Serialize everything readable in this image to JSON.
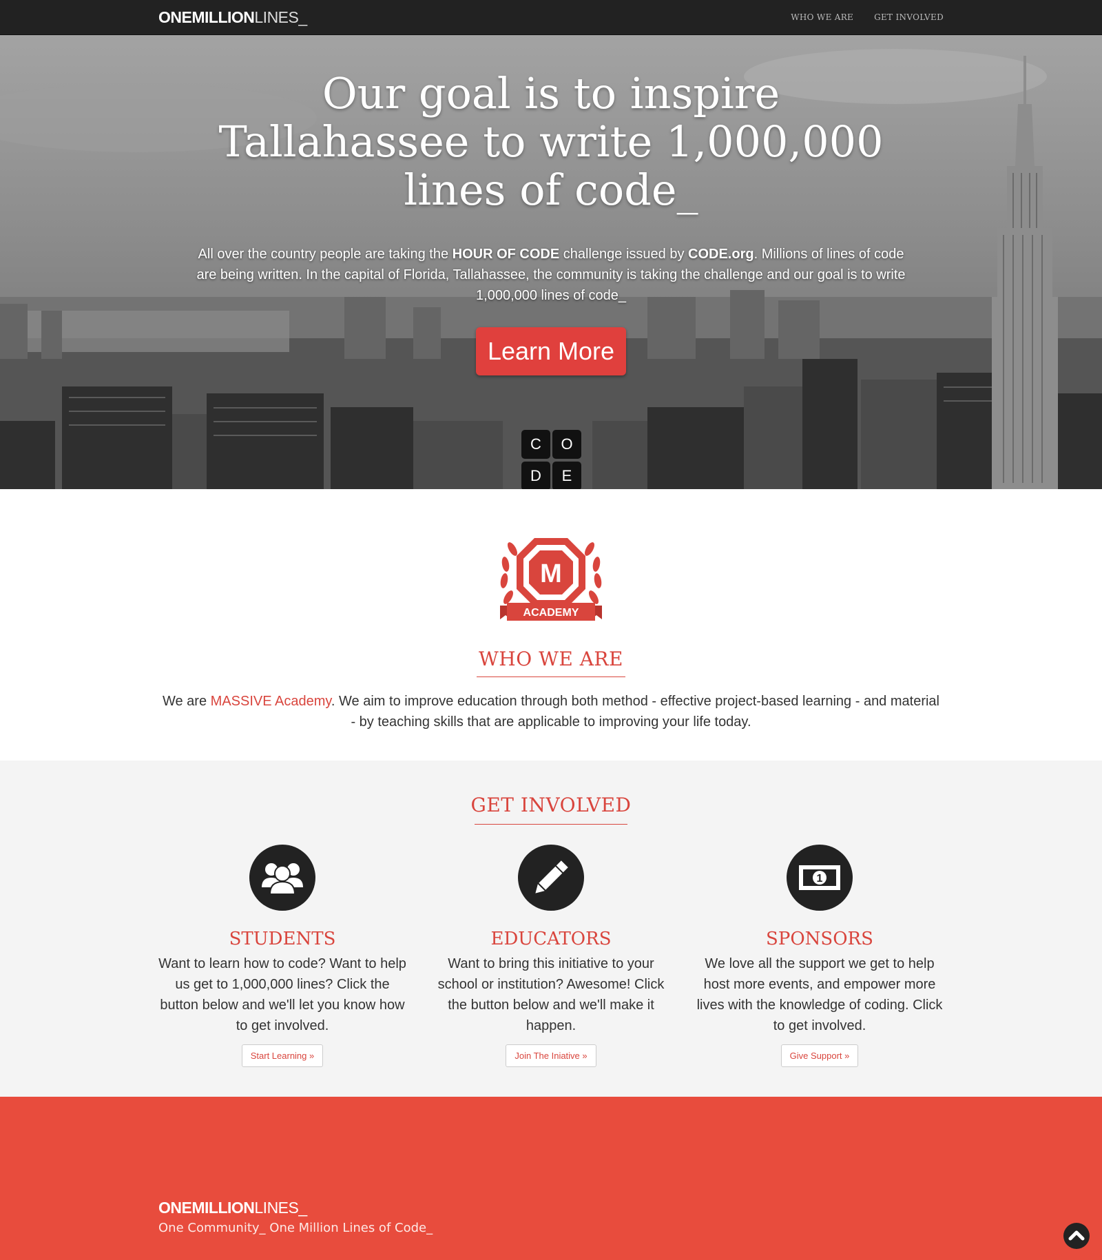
{
  "navbar": {
    "brand_bold": "ONEMILLION",
    "brand_thin": "LINES_",
    "links": [
      "WHO WE ARE",
      "GET INVOLVED"
    ]
  },
  "hero": {
    "title": "Our goal is to inspire Tallahassee to write 1,000,000 lines of code_",
    "text_1": "All over the country people are taking the ",
    "text_hour": "HOUR OF CODE",
    "text_2": " challenge issued by ",
    "text_codeorg": "CODE.org",
    "text_3": ". Millions of lines of code are being written. In the capital of Florida, Tallahassee, the community is taking the challenge and our goal is to write 1,000,000 lines of code_",
    "button": "Learn More",
    "code_letters": [
      "C",
      "O",
      "D",
      "E"
    ]
  },
  "who": {
    "badge_letter": "M",
    "badge_ribbon": "ACADEMY",
    "title": "WHO WE ARE",
    "text_1": "We are ",
    "text_accent": "MASSIVE Academy",
    "text_2": ". We aim to improve education through both method - effective project-based learning - and material - by teaching skills that are applicable to improving your life today."
  },
  "involved": {
    "title": "GET INVOLVED",
    "columns": [
      {
        "icon": "users-icon",
        "title": "STUDENTS",
        "text": "Want to learn how to code? Want to help us get to 1,000,000 lines? Click the button below and we'll let you know how to get involved.",
        "button": "Start Learning »"
      },
      {
        "icon": "pencil-icon",
        "title": "EDUCATORS",
        "text": "Want to bring this initiative to your school or institution? Awesome! Click the button below and we'll make it happen.",
        "button": "Join The Iniative »"
      },
      {
        "icon": "money-icon",
        "title": "SPONSORS",
        "text": "We love all the support we get to help host more events, and empower more lives with the knowledge of coding. Click to get involved.",
        "button": "Give Support »"
      }
    ],
    "money_digit": "1"
  },
  "footer": {
    "brand_bold": "ONEMILLION",
    "brand_thin": "LINES_",
    "tagline": "One Community_ One Million Lines of Code_"
  },
  "colors": {
    "accent": "#d9453d",
    "footer_bg": "#e84c3d",
    "navbar_bg": "#222222",
    "button_red": "#e0403d"
  }
}
